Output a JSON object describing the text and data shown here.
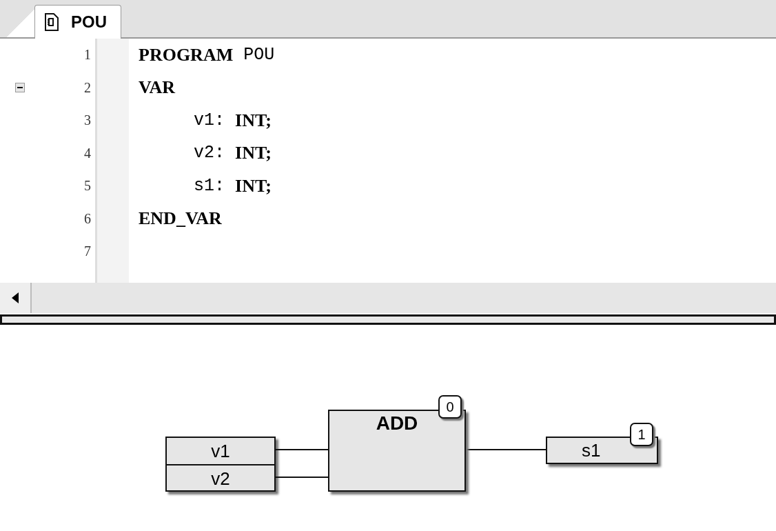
{
  "tabs": [
    {
      "label": "POU",
      "selected": true
    }
  ],
  "lines": [
    {
      "number": "1",
      "tokens": [
        {
          "text": "PROGRAM",
          "kind": "keyword"
        },
        {
          "text": "POU",
          "kind": "plain"
        }
      ]
    },
    {
      "number": "2",
      "tokens": [
        {
          "text": "VAR",
          "kind": "keyword"
        }
      ],
      "expanded": true,
      "children": [
        {
          "number": "3",
          "tokens": [
            {
              "text": "v1:",
              "kind": "plain"
            },
            {
              "text": "INT;",
              "kind": "keyword"
            }
          ]
        },
        {
          "number": "4",
          "tokens": [
            {
              "text": "v2:",
              "kind": "plain"
            },
            {
              "text": "INT;",
              "kind": "keyword"
            }
          ]
        },
        {
          "number": "5",
          "tokens": [
            {
              "text": "s1:",
              "kind": "plain"
            },
            {
              "text": "INT;",
              "kind": "keyword"
            }
          ]
        }
      ]
    },
    {
      "number": "6",
      "tokens": [
        {
          "text": "END_VAR",
          "kind": "keyword"
        }
      ]
    },
    {
      "number": "7"
    }
  ],
  "diagram": {
    "inputs": [
      "v1",
      "v2"
    ],
    "block": {
      "title": "ADD",
      "badge": "0"
    },
    "output": {
      "text": "s1",
      "badge": "1"
    }
  }
}
